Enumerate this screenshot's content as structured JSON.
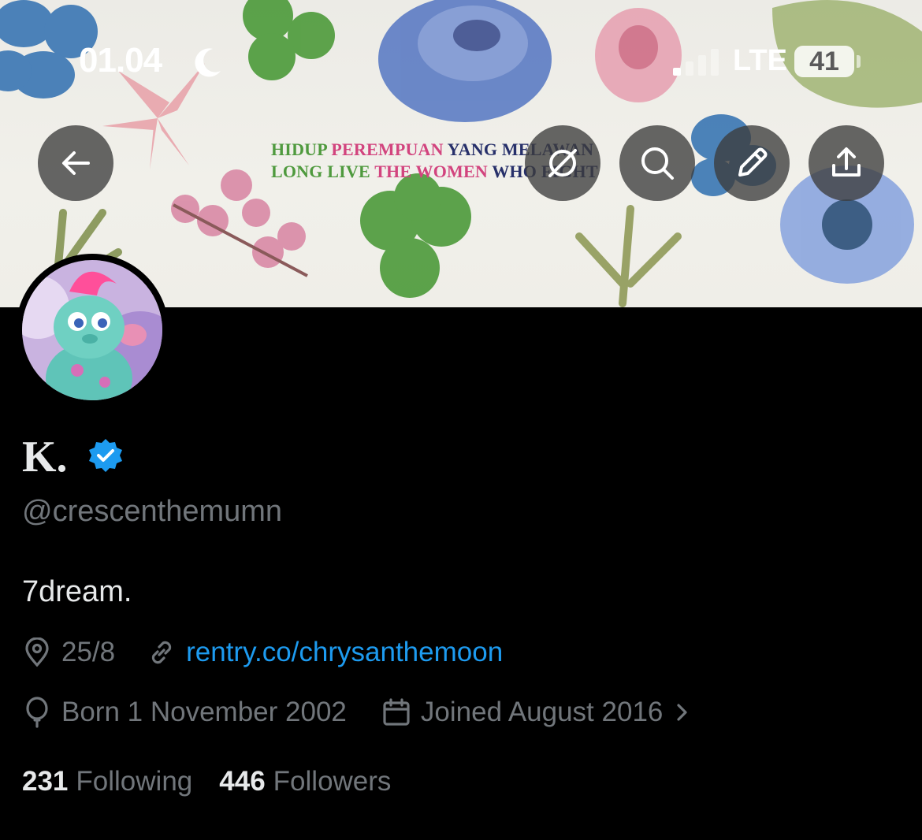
{
  "status_bar": {
    "time": "01.04",
    "network": "LTE",
    "battery": "41"
  },
  "banner": {
    "line1": [
      "HIDUP ",
      "PEREMPUAN ",
      "YANG MELAWAN"
    ],
    "line2": [
      "LONG LIVE ",
      "THE WOMEN ",
      "WHO FIGHT"
    ]
  },
  "profile": {
    "display_name": "K.",
    "handle": "@crescenthemumn",
    "bio": "7dream.",
    "location": "25/8",
    "website": "rentry.co/chrysanthemoon",
    "birthday": "Born 1 November 2002",
    "joined": "Joined August 2016",
    "following_count": "231",
    "following_label": "Following",
    "followers_count": "446",
    "followers_label": "Followers"
  },
  "colors": {
    "accent": "#1d9bf0",
    "muted_text": "#71767b",
    "primary_text": "#e7e9ea",
    "background": "#000000"
  },
  "icons": [
    "back-arrow-icon",
    "grok-icon",
    "search-icon",
    "edit-pencil-icon",
    "share-icon",
    "location-pin-icon",
    "link-icon",
    "balloon-icon",
    "calendar-icon",
    "chevron-right-icon",
    "verified-badge-icon",
    "moon-icon",
    "signal-icon"
  ]
}
